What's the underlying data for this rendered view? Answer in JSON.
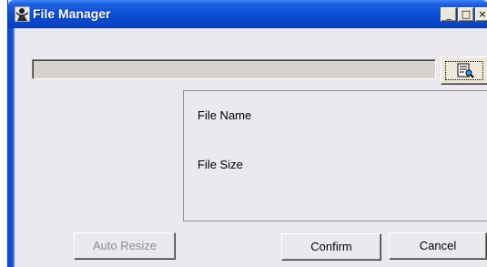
{
  "window": {
    "title": "File Manager",
    "icon": "app-icon",
    "minimize_label": "_",
    "maximize_label": "□",
    "close_label": "×"
  },
  "path": {
    "value": ""
  },
  "browse": {
    "icon": "browse-folder-icon"
  },
  "info": {
    "file_name_label": "File Name",
    "file_size_label": "File Size"
  },
  "buttons": {
    "auto_resize": "Auto Resize",
    "confirm": "Confirm",
    "cancel": "Cancel"
  },
  "colors": {
    "titlebar": "#0a4fd8",
    "window_bg": "#ebe9ed",
    "path_bg": "#d6d3ce",
    "disabled_text": "#8d8d8d"
  }
}
